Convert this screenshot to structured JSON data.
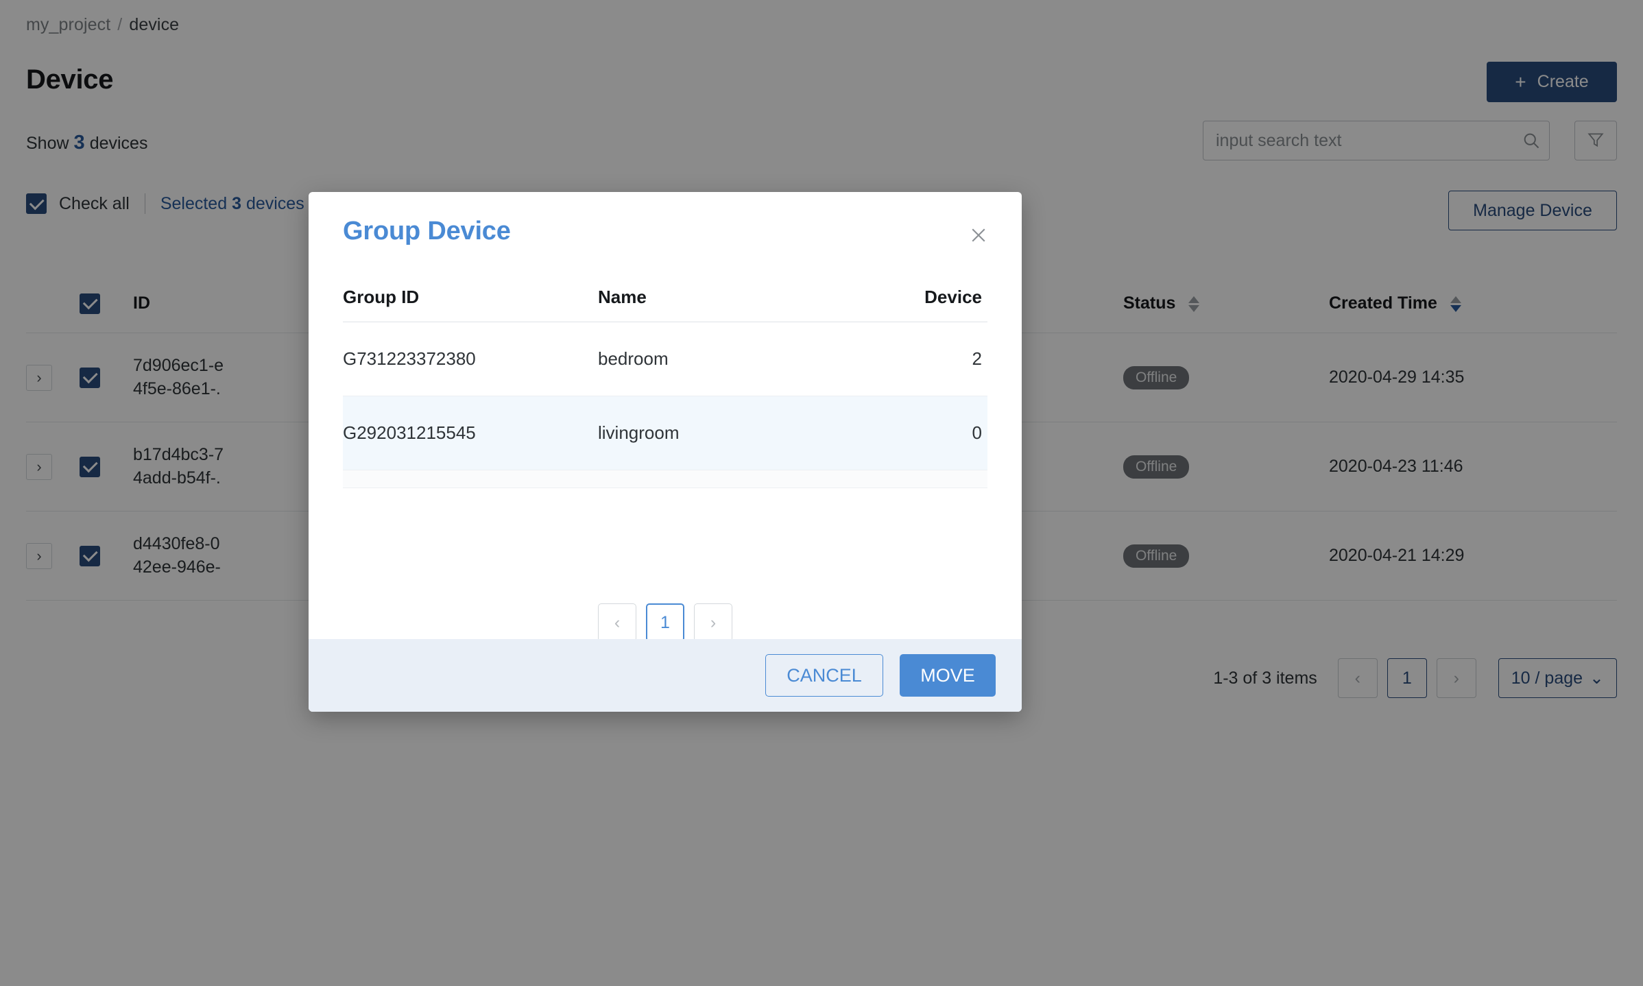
{
  "breadcrumb": {
    "project": "my_project",
    "separator": "/",
    "current": "device"
  },
  "header": {
    "title": "Device",
    "show_prefix": "Show",
    "show_count": "3",
    "show_suffix": "devices",
    "create_label": "Create",
    "create_icon": "plus-icon"
  },
  "search": {
    "placeholder": "input search text",
    "value": "",
    "icon": "search-icon"
  },
  "filter": {
    "icon": "filter-icon"
  },
  "selection": {
    "check_all_label": "Check all",
    "selected_prefix": "Selected",
    "selected_count": "3",
    "selected_suffix": "devices",
    "manage_label": "Manage Device"
  },
  "table": {
    "columns": [
      "ID",
      "Status",
      "Created Time"
    ],
    "status_sort_icon": "sort-arrows-icon",
    "time_sort_icon": "sort-arrows-icon",
    "rows": [
      {
        "id_line1": "7d906ec1-e",
        "id_line2": "4f5e-86e1-.",
        "status": "Offline",
        "created": "2020-04-29 14:35",
        "expand_icon": "chevron-right-icon"
      },
      {
        "id_line1": "b17d4bc3-7",
        "id_line2": "4add-b54f-.",
        "status": "Offline",
        "created": "2020-04-23 11:46",
        "expand_icon": "chevron-right-icon"
      },
      {
        "id_line1": "d4430fe8-0",
        "id_line2": "42ee-946e-",
        "status": "Offline",
        "created": "2020-04-21 14:29",
        "expand_icon": "chevron-right-icon"
      }
    ]
  },
  "pagination": {
    "items_text": "1-3 of 3 items",
    "prev_icon": "chevron-left-icon",
    "next_icon": "chevron-right-icon",
    "current_page": "1",
    "page_size": "10 / page",
    "page_size_icon": "chevron-down-icon"
  },
  "modal": {
    "title": "Group Device",
    "close_icon": "close-icon",
    "columns": [
      "Group ID",
      "Name",
      "Device"
    ],
    "rows": [
      {
        "group_id": "G731223372380",
        "name": "bedroom",
        "device": "2",
        "selected": false
      },
      {
        "group_id": "G292031215545",
        "name": "livingroom",
        "device": "0",
        "selected": true
      }
    ],
    "pagination": {
      "prev_icon": "chevron-left-icon",
      "next_icon": "chevron-right-icon",
      "current_page": "1"
    },
    "cancel_label": "CANCEL",
    "move_label": "MOVE"
  },
  "colors": {
    "brand_dark": "#2a4c7d",
    "brand_light": "#4a8ad4",
    "link": "#2a5b9c",
    "status_pill_bg": "#6e7378",
    "selected_row_bg": "#f2f8fd",
    "modal_footer_bg": "#e9eff7",
    "overlay": "rgba(0,0,0,0.455)"
  }
}
